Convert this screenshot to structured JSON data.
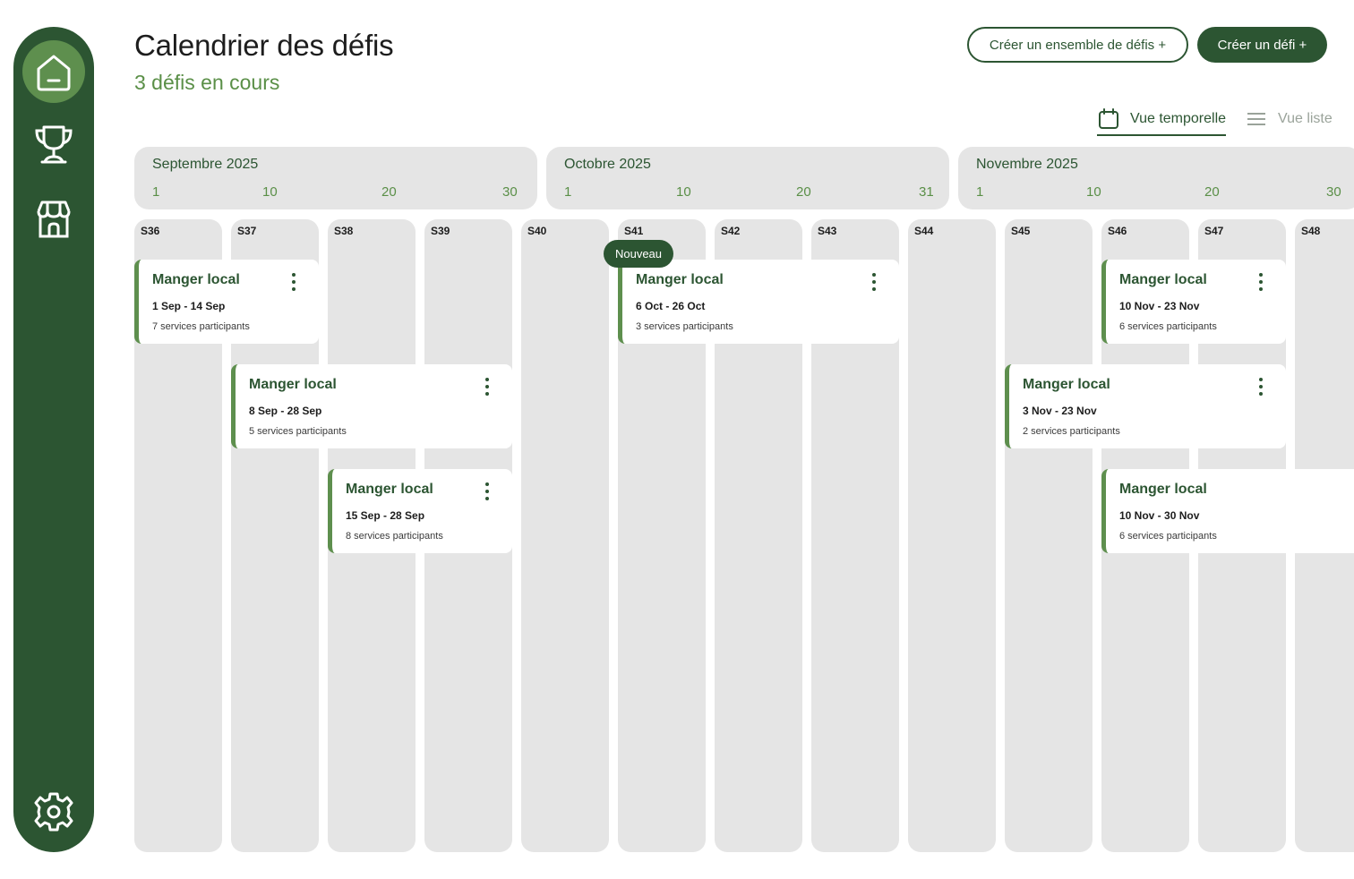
{
  "header": {
    "title": "Calendrier des défis",
    "subtitle": "3 défis en cours"
  },
  "actions": {
    "create_set": "Créer un ensemble de défis +",
    "create_challenge": "Créer un défi +"
  },
  "views": {
    "timeline": "Vue temporelle",
    "list": "Vue liste",
    "active": "timeline"
  },
  "sidebar": {
    "items": [
      {
        "icon": "home-icon",
        "active": true
      },
      {
        "icon": "trophy-icon",
        "active": false
      },
      {
        "icon": "store-icon",
        "active": false
      }
    ],
    "footer_icon": "gear-icon"
  },
  "months": [
    {
      "label": "Septembre 2025",
      "ticks": [
        "1",
        "10",
        "20",
        "30"
      ]
    },
    {
      "label": "Octobre 2025",
      "ticks": [
        "1",
        "10",
        "20",
        "31"
      ]
    },
    {
      "label": "Novembre 2025",
      "ticks": [
        "1",
        "10",
        "20",
        "30"
      ]
    }
  ],
  "weeks": [
    "S36",
    "S37",
    "S38",
    "S39",
    "S40",
    "S41",
    "S42",
    "S43",
    "S44",
    "S45",
    "S46",
    "S47",
    "S48"
  ],
  "badge": "Nouveau",
  "challenges": [
    {
      "title": "Manger local",
      "dates": "1 Sep - 14 Sep",
      "services": "7 services participants"
    },
    {
      "title": "Manger local",
      "dates": "8 Sep - 28 Sep",
      "services": "5 services participants"
    },
    {
      "title": "Manger local",
      "dates": "15 Sep - 28 Sep",
      "services": "8 services participants"
    },
    {
      "title": "Manger local",
      "dates": "6 Oct - 26 Oct",
      "services": "3 services participants"
    },
    {
      "title": "Manger local",
      "dates": "10 Nov - 23 Nov",
      "services": "6 services participants"
    },
    {
      "title": "Manger local",
      "dates": "3 Nov - 23 Nov",
      "services": "2 services participants"
    },
    {
      "title": "Manger local",
      "dates": "10 Nov - 30 Nov",
      "services": "6 services participants"
    }
  ],
  "colors": {
    "primary": "#2c5532",
    "accent": "#5e8f4e",
    "column_bg": "#e5e5e5"
  }
}
